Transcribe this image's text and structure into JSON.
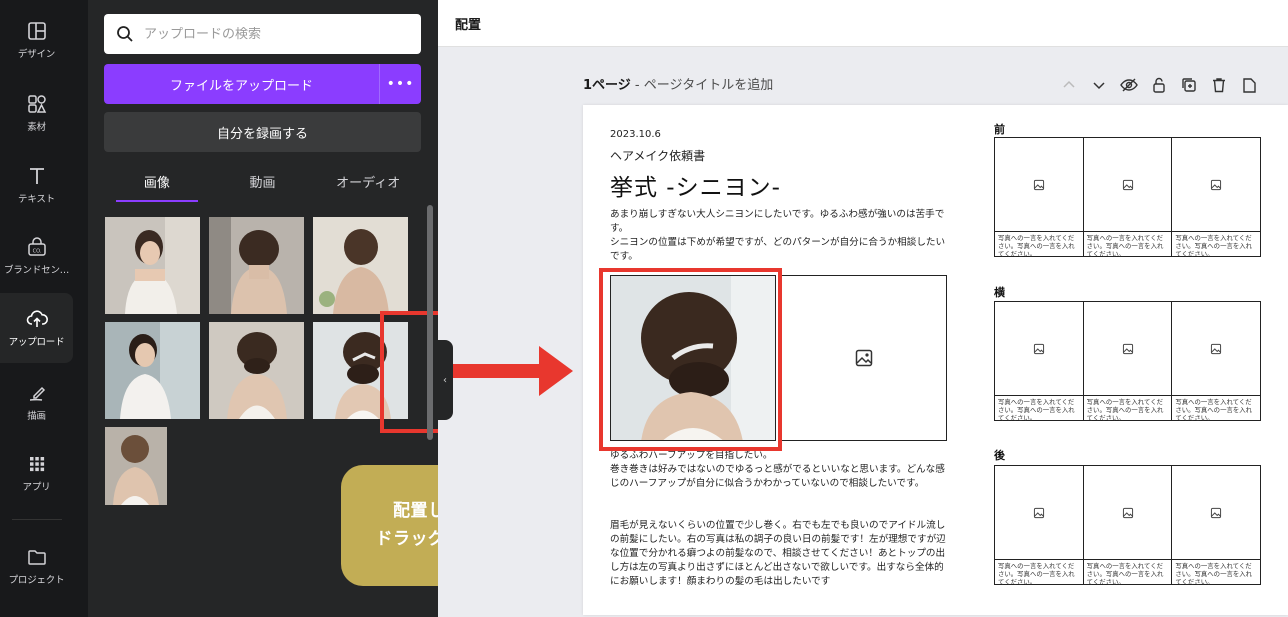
{
  "rail": {
    "items": [
      {
        "label": "デザイン",
        "icon": "layout-icon"
      },
      {
        "label": "素材",
        "icon": "elements-icon"
      },
      {
        "label": "テキスト",
        "icon": "text-icon"
      },
      {
        "label": "ブランドセン…",
        "icon": "brand-icon"
      },
      {
        "label": "アップロード",
        "icon": "upload-icon"
      },
      {
        "label": "描画",
        "icon": "draw-icon"
      },
      {
        "label": "アプリ",
        "icon": "apps-icon"
      },
      {
        "label": "プロジェクト",
        "icon": "folder-icon"
      }
    ],
    "active_index": 4
  },
  "panel": {
    "search_placeholder": "アップロードの検索",
    "upload_label": "ファイルをアップロード",
    "more_label": "•••",
    "record_label": "自分を録画する",
    "tabs": [
      "画像",
      "動画",
      "オーディオ"
    ],
    "active_tab": 0,
    "collapse_glyph": "‹"
  },
  "callout": {
    "line1": "配置したい場所に",
    "line2": "ドラッグ＆コピーする"
  },
  "topbar": {
    "title": "配置"
  },
  "page": {
    "page_label": "1ページ",
    "page_title_hint": " - ページタイトルを追加",
    "date": "2023.10.6",
    "subtitle": "ヘアメイク依頼書",
    "title": "挙式 -シニヨン-",
    "para1": "あまり崩しすぎない大人シニヨンにしたいです。ゆるふわ感が強いのは苦手です。",
    "para2": "シニヨンの位置は下めが希望ですが、どのパターンが自分に合うか相談したいです。",
    "para3a": "ゆるふわハーフアップを目指したい。",
    "para3b": "巻き巻きは好みではないのでゆるっと感がでるといいなと思います。どんな感じのハーフアップが自分に似合うかわかっていないので相談したいです。",
    "para4": "眉毛が見えないくらいの位置で少し巻く。右でも左でも良いのでアイドル流しの前髪にしたい。右の写真は私の調子の良い日の前髪です！左が理想ですが辺な位置で分かれる癖つよの前髪なので、相談させてください！あとトップの出し方は左の写真より出さずにほとんど出さないで欲しいです。出すなら全体的にお願いします！顔まわりの髪の毛は出したいです",
    "sections": [
      "前",
      "横",
      "後"
    ],
    "caption": "写真への一言を入れてください。写真への一言を入れてください。"
  }
}
